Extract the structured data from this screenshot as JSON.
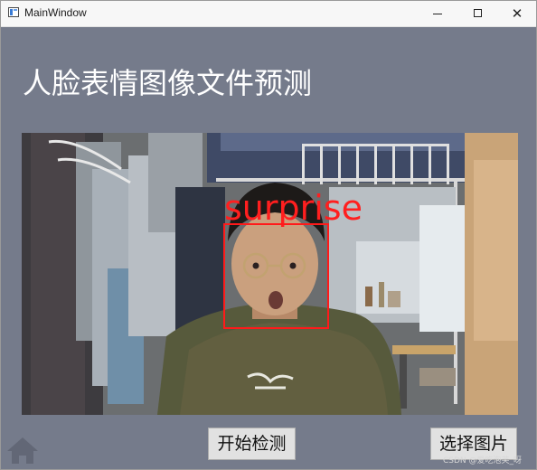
{
  "window": {
    "title": "MainWindow",
    "minimize_icon": "minimize-icon",
    "maximize_icon": "maximize-icon",
    "close_icon": "close-icon",
    "close_glyph": "✕"
  },
  "main": {
    "heading": "人脸表情图像文件预测",
    "video": {
      "detected_emotion": "surprise",
      "box_color": "#ff1a1a"
    },
    "buttons": {
      "start_detection": "开始检测",
      "select_image": "选择图片"
    },
    "home_icon": "home-icon"
  },
  "watermark": "CSDN @爱吃泡芙_呀",
  "colors": {
    "background": "#757b8b",
    "titlebar": "#f7f7f7",
    "heading_text": "#ffffff",
    "annotation_red": "#ff1a1a"
  }
}
